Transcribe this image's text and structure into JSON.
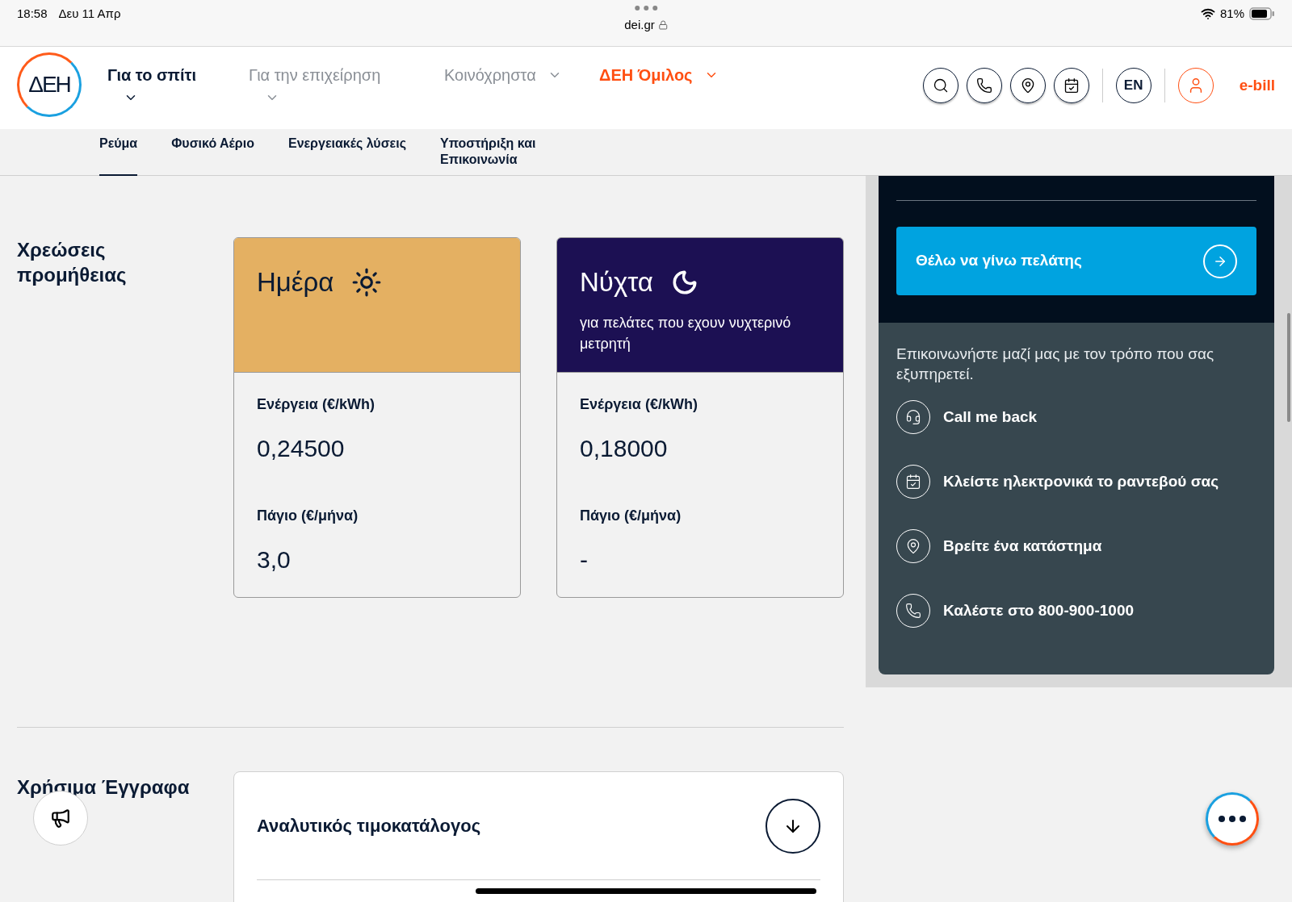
{
  "status_bar": {
    "time": "18:58",
    "date": "Δευ 11 Απρ",
    "url": "dei.gr",
    "battery": "81%"
  },
  "header": {
    "logo": "ΔΕΗ",
    "nav": [
      {
        "label": "Για το σπίτι",
        "selected": true,
        "kind": "stacked"
      },
      {
        "label": "Για την επιχείρηση",
        "selected": false,
        "kind": "stacked"
      },
      {
        "label": "Κοινόχρηστα",
        "selected": false,
        "kind": "inline"
      },
      {
        "label": "ΔΕΗ Όμιλος",
        "selected": false,
        "kind": "inline",
        "color": "#ff4f12"
      }
    ],
    "tools": [
      {
        "kind": "search"
      },
      {
        "kind": "phone"
      },
      {
        "kind": "pin"
      },
      {
        "kind": "calendar"
      }
    ],
    "language": "EN",
    "ebill": "e-bill"
  },
  "subnav": [
    {
      "label": "Ρεύμα",
      "selected": true
    },
    {
      "label": "Φυσικό Αέριο",
      "selected": false
    },
    {
      "label": "Ενεργειακές λύσεις",
      "selected": false
    },
    {
      "label": "Υποστήριξη και Επικοινωνία",
      "selected": false
    }
  ],
  "charges": {
    "title": "Χρεώσεις προμήθειας",
    "cards": [
      {
        "kind": "day",
        "title": "Ημέρα",
        "rows": [
          {
            "label": "Ενέργεια (€/kWh)",
            "value": "0,24500"
          },
          {
            "label": "Πάγιο (€/μήνα)",
            "value": "3,0"
          }
        ]
      },
      {
        "kind": "night",
        "title": "Νύχτα",
        "subtitle": "για πελάτες που εχουν νυχτερινό μετρητή",
        "rows": [
          {
            "label": "Ενέργεια (€/kWh)",
            "value": "0,18000"
          },
          {
            "label": "Πάγιο (€/μήνα)",
            "value": "-"
          }
        ]
      }
    ]
  },
  "sidebar": {
    "cta": "Θέλω να γίνω πελάτης",
    "intro": "Επικοινωνήστε μαζί μας με τον τρόπο που σας εξυπηρετεί.",
    "contacts": [
      {
        "kind": "headset",
        "label": "Call me back"
      },
      {
        "kind": "calendar",
        "label": "Κλείστε ηλεκτρονικά το ραντεβού σας"
      },
      {
        "kind": "pin",
        "label": "Βρείτε ένα κατάστημα"
      },
      {
        "kind": "phone",
        "label": "Καλέστε στο 800-900-1000"
      }
    ]
  },
  "documents": {
    "title": "Χρήσιμα Έγγραφα",
    "items": [
      "Αναλυτικός τιμοκατάλογος"
    ]
  }
}
